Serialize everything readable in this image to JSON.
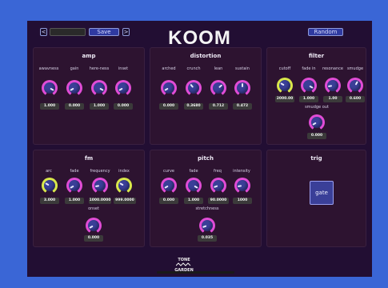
{
  "topbar": {
    "prev_label": "<",
    "preset_value": "",
    "save_label": "Save",
    "next_label": ">",
    "title": "KOOM",
    "random_label": "Random"
  },
  "colors": {
    "background": "#3a66d6",
    "app_bg": "#220e33",
    "panel": "#2d1330",
    "knob": "#3a3f98",
    "ring_magenta": "#e14cd6",
    "ring_yellow": "#d9e84a"
  },
  "panels": {
    "amp": {
      "title": "amp",
      "knobs": [
        {
          "label": "awavness",
          "value": "1.000"
        },
        {
          "label": "gain",
          "value": "0.000"
        },
        {
          "label": "here-ness",
          "value": "1.000"
        },
        {
          "label": "inset",
          "value": "0.000"
        }
      ]
    },
    "distortion": {
      "title": "distortion",
      "knobs": [
        {
          "label": "arched",
          "value": "0.000"
        },
        {
          "label": "crunch",
          "value": "0.3680"
        },
        {
          "label": "lean",
          "value": "0.712"
        },
        {
          "label": "sustain",
          "value": "0.472"
        }
      ]
    },
    "filter": {
      "title": "filter",
      "knobs": [
        {
          "label": "cutoff",
          "value": "2000.00"
        },
        {
          "label": "fade in",
          "value": "1.000"
        },
        {
          "label": "resonance",
          "value": "1.00"
        },
        {
          "label": "smudge",
          "value": "0.600"
        },
        {
          "label": "smudge out",
          "value": "0.000"
        }
      ]
    },
    "fm": {
      "title": "fm",
      "knobs": [
        {
          "label": "arc",
          "value": "3.000"
        },
        {
          "label": "fade",
          "value": "1.000"
        },
        {
          "label": "frequency",
          "value": "1000.0000"
        },
        {
          "label": "index",
          "value": "999.0000"
        },
        {
          "label": "onset",
          "value": "0.000"
        }
      ]
    },
    "pitch": {
      "title": "pitch",
      "knobs": [
        {
          "label": "curve",
          "value": "0.000"
        },
        {
          "label": "fade",
          "value": "1.000"
        },
        {
          "label": "freq",
          "value": "90.0000"
        },
        {
          "label": "intensity",
          "value": "1000"
        },
        {
          "label": "stretchness",
          "value": "0.035"
        }
      ]
    },
    "trig": {
      "title": "trig",
      "gate_label": "gate"
    }
  },
  "footer": {
    "logo_line1": "TONE",
    "logo_line2": "GARDEN"
  }
}
